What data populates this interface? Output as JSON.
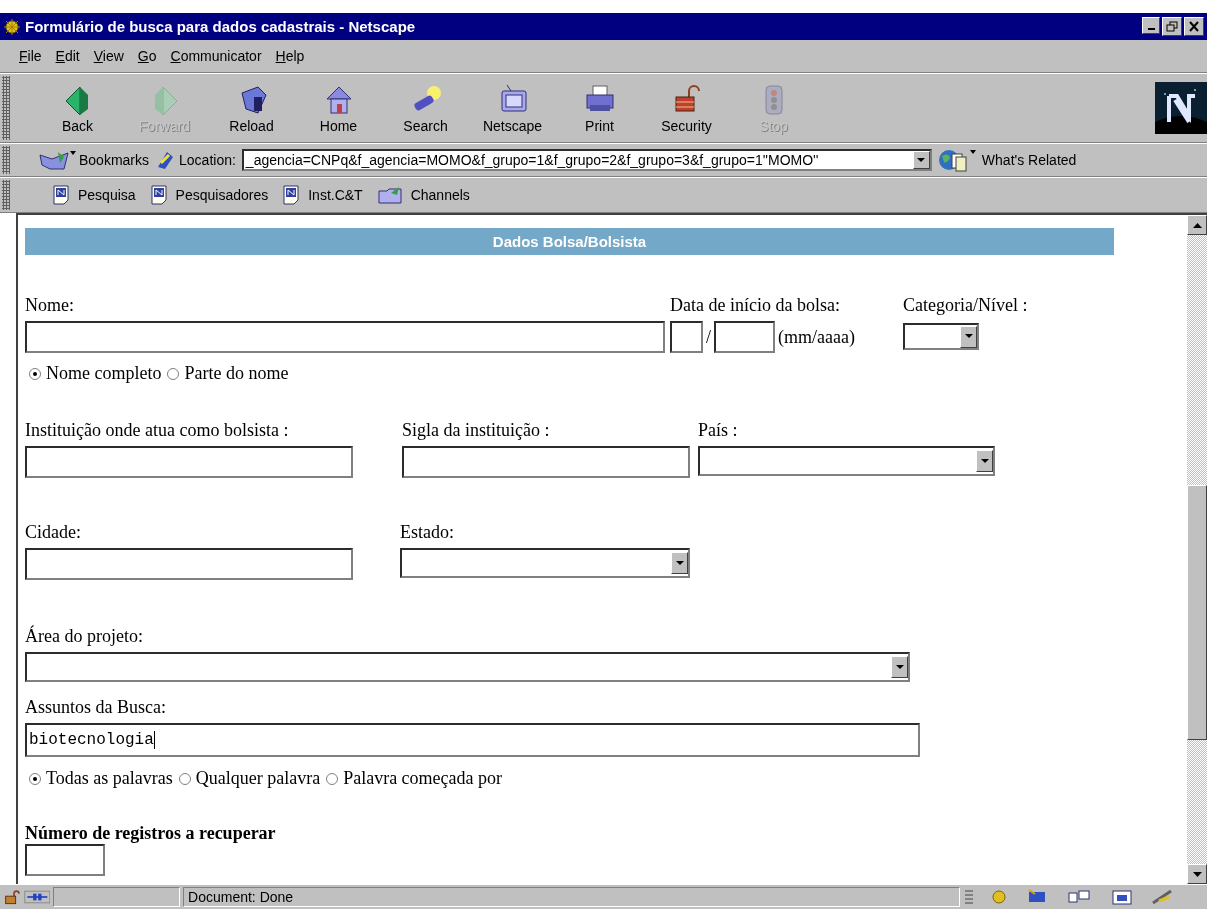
{
  "window": {
    "title": "Formulário de busca para dados cadastrais - Netscape"
  },
  "menu": [
    {
      "label": "File"
    },
    {
      "label": "Edit"
    },
    {
      "label": "View"
    },
    {
      "label": "Go"
    },
    {
      "label": "Communicator"
    },
    {
      "label": "Help"
    }
  ],
  "toolbar": [
    {
      "label": "Back",
      "kind": "back",
      "disabled": false
    },
    {
      "label": "Forward",
      "kind": "forward",
      "disabled": true
    },
    {
      "label": "Reload",
      "kind": "reload",
      "disabled": false
    },
    {
      "label": "Home",
      "kind": "home",
      "disabled": false
    },
    {
      "label": "Search",
      "kind": "search",
      "disabled": false
    },
    {
      "label": "Netscape",
      "kind": "my",
      "disabled": false
    },
    {
      "label": "Print",
      "kind": "print",
      "disabled": false
    },
    {
      "label": "Security",
      "kind": "security",
      "disabled": false
    },
    {
      "label": "Stop",
      "kind": "stop",
      "disabled": true
    }
  ],
  "location_bar": {
    "bookmarks": "Bookmarks",
    "label": "Location:",
    "value": "_agencia=CNPq&f_agencia=MOMO&f_grupo=1&f_grupo=2&f_grupo=3&f_grupo=1''MOMO''",
    "related": "What's Related"
  },
  "personal_bar": [
    {
      "label": "Pesquisa",
      "kind": "bookmark"
    },
    {
      "label": "Pesquisadores",
      "kind": "bookmark"
    },
    {
      "label": "Inst.C&T",
      "kind": "bookmark"
    },
    {
      "label": "Channels",
      "kind": "folder"
    }
  ],
  "form": {
    "section_title": "Dados Bolsa/Bolsista",
    "nome": {
      "label": "Nome:"
    },
    "data_inicio": {
      "label": "Data de início da bolsa:",
      "separator": "/",
      "format": "(mm/aaaa)"
    },
    "categoria": {
      "label": "Categoria/Nível :"
    },
    "name_match": [
      {
        "label": "Nome completo",
        "selected": true
      },
      {
        "label": "Parte do nome",
        "selected": false
      }
    ],
    "instituicao": {
      "label": "Instituição onde atua como bolsista :"
    },
    "sigla": {
      "label": "Sigla da instituição :"
    },
    "pais": {
      "label": "País :"
    },
    "cidade": {
      "label": "Cidade:"
    },
    "estado": {
      "label": "Estado:"
    },
    "area": {
      "label": "Área do projeto:"
    },
    "assuntos": {
      "label": "Assuntos da Busca:",
      "value": "biotecnologia"
    },
    "word_match": [
      {
        "label": "Todas as palavras",
        "selected": true
      },
      {
        "label": "Qualquer palavra",
        "selected": false
      },
      {
        "label": "Palavra começada por",
        "selected": false
      }
    ],
    "registros": {
      "label": "Número de registros a recuperar"
    }
  },
  "status_bar": {
    "text": "Document: Done"
  }
}
